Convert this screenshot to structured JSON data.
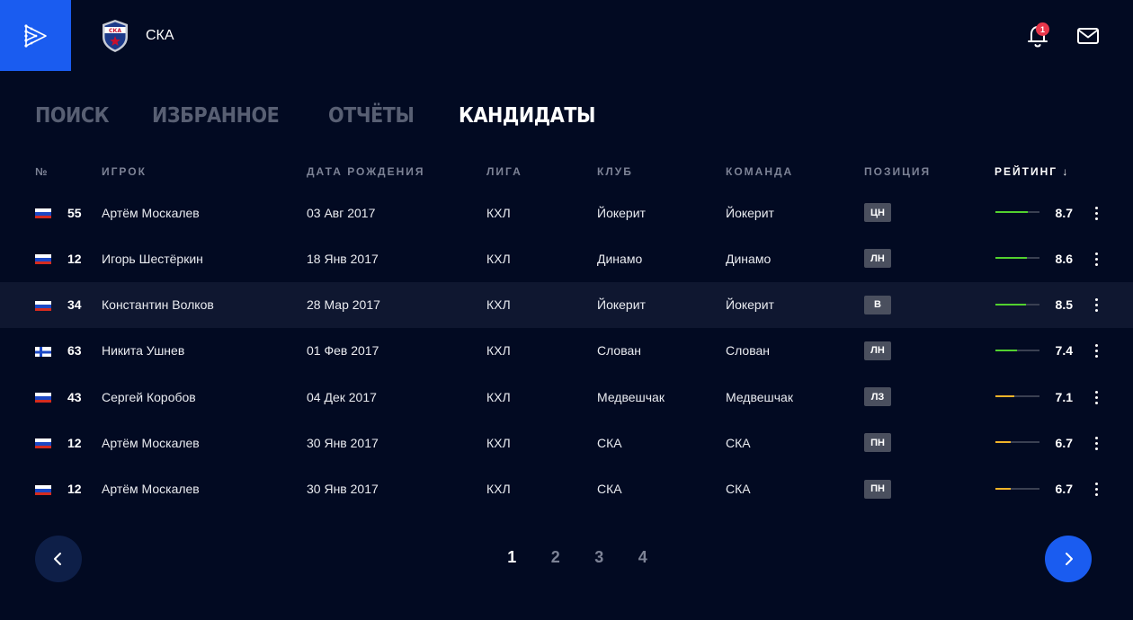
{
  "header": {
    "club_name": "СКА",
    "club_logo_text": "СКА",
    "notifications_count": "1"
  },
  "tabs": [
    {
      "label": "ПОИСК",
      "active": false
    },
    {
      "label": "ИЗБРАННОЕ",
      "active": false
    },
    {
      "label": "ОТЧЁТЫ",
      "active": false
    },
    {
      "label": "КАНДИДАТЫ",
      "active": true
    }
  ],
  "table": {
    "columns": {
      "number": "№",
      "player": "ИГРОК",
      "birth_date": "ДАТА РОЖДЕНИЯ",
      "league": "ЛИГА",
      "club": "КЛУБ",
      "team": "КОМАНДА",
      "position": "ПОЗИЦИЯ",
      "rating": "РЕЙТИНГ ↓"
    },
    "rows": [
      {
        "flag": "ru",
        "number": "55",
        "player": "Артём Москалев",
        "birth_date": "03 Авг 2017",
        "league": "КХЛ",
        "club": "Йокерит",
        "team": "Йокерит",
        "position": "ЦН",
        "rating": "8.7",
        "rating_value": 8.7,
        "bar_color": "#52d12f",
        "highlight": false
      },
      {
        "flag": "ru",
        "number": "12",
        "player": "Игорь Шестёркин",
        "birth_date": "18 Янв 2017",
        "league": "КХЛ",
        "club": "Динамо",
        "team": "Динамо",
        "position": "ЛН",
        "rating": "8.6",
        "rating_value": 8.6,
        "bar_color": "#52d12f",
        "highlight": false
      },
      {
        "flag": "ru",
        "number": "34",
        "player": "Константин Волков",
        "birth_date": "28 Мар 2017",
        "league": "КХЛ",
        "club": "Йокерит",
        "team": "Йокерит",
        "position": "В",
        "rating": "8.5",
        "rating_value": 8.5,
        "bar_color": "#52d12f",
        "highlight": true
      },
      {
        "flag": "fi",
        "number": "63",
        "player": "Никита Ушнев",
        "birth_date": "01 Фев 2017",
        "league": "КХЛ",
        "club": "Слован",
        "team": "Слован",
        "position": "ЛН",
        "rating": "7.4",
        "rating_value": 7.4,
        "bar_color": "#52d12f",
        "highlight": false
      },
      {
        "flag": "ru",
        "number": "43",
        "player": "Сергей Коробов",
        "birth_date": "04 Дек 2017",
        "league": "КХЛ",
        "club": "Медвешчак",
        "team": "Медвешчак",
        "position": "ЛЗ",
        "rating": "7.1",
        "rating_value": 7.1,
        "bar_color": "#f0b429",
        "highlight": false
      },
      {
        "flag": "ru",
        "number": "12",
        "player": "Артём Москалев",
        "birth_date": "30 Янв 2017",
        "league": "КХЛ",
        "club": "СКА",
        "team": "СКА",
        "position": "ПН",
        "rating": "6.7",
        "rating_value": 6.7,
        "bar_color": "#f0b429",
        "highlight": false
      },
      {
        "flag": "ru",
        "number": "12",
        "player": "Артём Москалев",
        "birth_date": "30 Янв 2017",
        "league": "КХЛ",
        "club": "СКА",
        "team": "СКА",
        "position": "ПН",
        "rating": "6.7",
        "rating_value": 6.7,
        "bar_color": "#f0b429",
        "highlight": false
      }
    ]
  },
  "pagination": {
    "pages": [
      "1",
      "2",
      "3",
      "4"
    ],
    "current": "1"
  },
  "colors": {
    "background": "#020a22",
    "accent": "#1a5cf0",
    "row_highlight": "#0f1730",
    "badge": "#e8364a"
  },
  "icons": {
    "logo": "play-arrow-dots-icon",
    "club": "ska-shield-icon",
    "notifications": "bell-icon",
    "mail": "envelope-icon",
    "row_menu": "kebab-menu-icon",
    "prev": "chevron-left-icon",
    "next": "chevron-right-icon"
  }
}
